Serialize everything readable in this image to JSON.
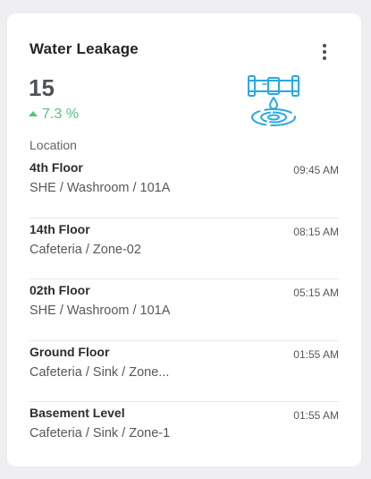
{
  "widget": {
    "title": "Water Leakage",
    "count": "15",
    "trend": "7.3 %",
    "trend_direction": "up",
    "trend_color": "#53c47f",
    "icon": "pipe-leak-icon",
    "icon_color": "#29a9e0",
    "section_label": "Location"
  },
  "locations": [
    {
      "title": "4th Floor",
      "subtitle": "SHE / Washroom / 101A",
      "time": "09:45 AM"
    },
    {
      "title": "14th Floor",
      "subtitle": "Cafeteria / Zone-02",
      "time": "08:15 AM"
    },
    {
      "title": "02th Floor",
      "subtitle": "SHE / Washroom / 101A",
      "time": "05:15 AM"
    },
    {
      "title": "Ground Floor",
      "subtitle": "Cafeteria / Sink / Zone...",
      "time": "01:55 AM"
    },
    {
      "title": "Basement Level",
      "subtitle": "Cafeteria / Sink / Zone-1",
      "time": "01:55 AM"
    }
  ]
}
